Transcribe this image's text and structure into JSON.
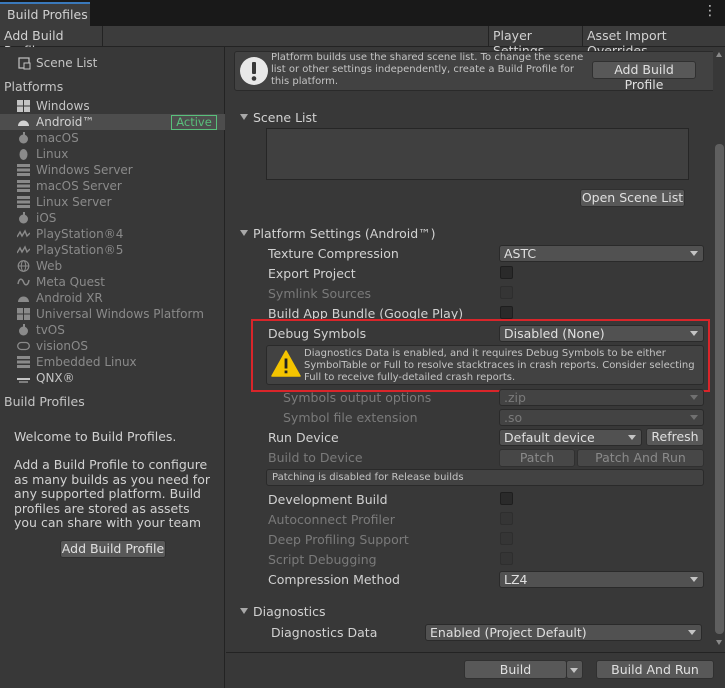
{
  "tab": {
    "title": "Build Profiles"
  },
  "toolbar": {
    "add_build_profile": "Add Build Profile",
    "player_settings": "Player Settings",
    "asset_import_overrides": "Asset Import Overrides"
  },
  "sidebar": {
    "scene_list": "Scene List",
    "platforms_header": "Platforms",
    "platforms": [
      {
        "label": "Windows",
        "icon": "windows-icon"
      },
      {
        "label": "Android™",
        "icon": "android-icon",
        "badge": "Active"
      },
      {
        "label": "macOS",
        "icon": "apple-icon"
      },
      {
        "label": "Linux",
        "icon": "linux-icon"
      },
      {
        "label": "Windows Server",
        "icon": "server-icon"
      },
      {
        "label": "macOS Server",
        "icon": "server-icon"
      },
      {
        "label": "Linux Server",
        "icon": "server-icon"
      },
      {
        "label": "iOS",
        "icon": "apple-icon"
      },
      {
        "label": "PlayStation®4",
        "icon": "playstation-icon"
      },
      {
        "label": "PlayStation®5",
        "icon": "playstation-icon"
      },
      {
        "label": "Web",
        "icon": "globe-icon"
      },
      {
        "label": "Meta Quest",
        "icon": "meta-icon"
      },
      {
        "label": "Android XR",
        "icon": "android-icon"
      },
      {
        "label": "Universal Windows Platform",
        "icon": "windows-icon"
      },
      {
        "label": "tvOS",
        "icon": "apple-icon"
      },
      {
        "label": "visionOS",
        "icon": "visionos-icon"
      },
      {
        "label": "Embedded Linux",
        "icon": "server-icon"
      },
      {
        "label": "QNX®",
        "icon": "qnx-icon"
      }
    ],
    "build_profiles_header": "Build Profiles",
    "welcome": "Welcome to Build Profiles.",
    "description": "Add a Build Profile to configure as many builds as you need for any supported platform. Build profiles are stored as assets you can share with your team",
    "add_button": "Add Build Profile"
  },
  "main": {
    "info_text": "Platform builds use the shared scene list. To change the scene list or other settings independently, create a Build Profile for this platform.",
    "info_button": "Add Build Profile",
    "scene_list": {
      "title": "Scene List",
      "open_button": "Open Scene List"
    },
    "platform_settings": {
      "title": "Platform Settings (Android™)",
      "texture_compression": {
        "label": "Texture Compression",
        "value": "ASTC"
      },
      "export_project": {
        "label": "Export Project"
      },
      "symlink_sources": {
        "label": "Symlink Sources"
      },
      "build_app_bundle": {
        "label": "Build App Bundle (Google Play)"
      },
      "debug_symbols": {
        "label": "Debug Symbols",
        "value": "Disabled (None)"
      },
      "warning": "Diagnostics Data is enabled, and it requires Debug Symbols to be either SymbolTable or Full to resolve stacktraces in crash reports. Consider selecting Full to receive fully-detailed crash reports.",
      "symbols_output": {
        "label": "Symbols output options",
        "value": ".zip"
      },
      "symbol_ext": {
        "label": "Symbol file extension",
        "value": ".so"
      },
      "run_device": {
        "label": "Run Device",
        "value": "Default device",
        "refresh": "Refresh"
      },
      "build_to_device": {
        "label": "Build to Device",
        "patch": "Patch",
        "patch_and_run": "Patch And Run"
      },
      "patching_note": "Patching is disabled for Release builds",
      "development_build": {
        "label": "Development Build"
      },
      "autoconnect_profiler": {
        "label": "Autoconnect Profiler"
      },
      "deep_profiling": {
        "label": "Deep Profiling Support"
      },
      "script_debugging": {
        "label": "Script Debugging"
      },
      "compression_method": {
        "label": "Compression Method",
        "value": "LZ4"
      }
    },
    "diagnostics": {
      "title": "Diagnostics",
      "data_label": "Diagnostics Data",
      "data_value": "Enabled (Project Default)"
    }
  },
  "footer": {
    "build": "Build",
    "build_and_run": "Build And Run"
  },
  "colors": {
    "accent": "#3a79bb",
    "active_badge": "#59c07b",
    "highlight_box": "#d9252a",
    "warning": "#f4c400"
  }
}
